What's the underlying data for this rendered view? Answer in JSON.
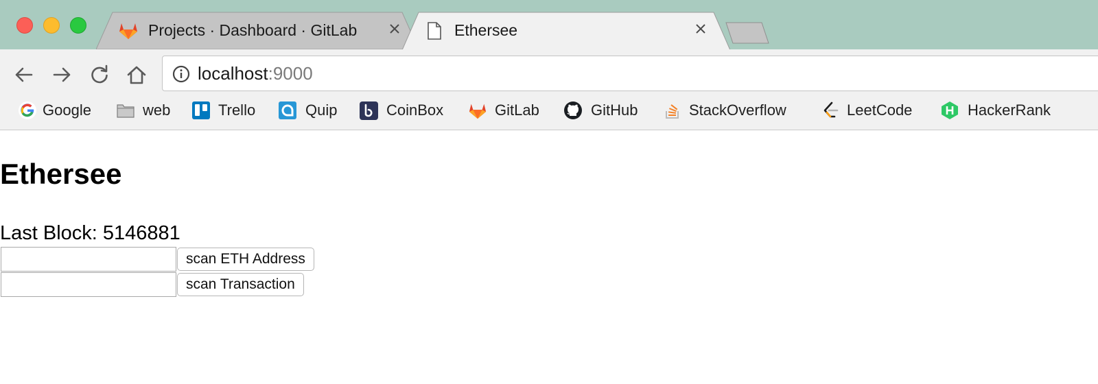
{
  "browser": {
    "tabs": [
      {
        "title": "Projects · Dashboard · GitLab",
        "icon": "gitlab-icon",
        "active": false
      },
      {
        "title": "Ethersee",
        "icon": "page-icon",
        "active": true
      }
    ],
    "address_bar": {
      "host": "localhost",
      "port": ":9000"
    },
    "bookmarks": [
      {
        "label": "Google",
        "icon": "google-icon"
      },
      {
        "label": "web",
        "icon": "folder-icon"
      },
      {
        "label": "Trello",
        "icon": "trello-icon"
      },
      {
        "label": "Quip",
        "icon": "quip-icon"
      },
      {
        "label": "CoinBox",
        "icon": "coinbox-icon"
      },
      {
        "label": "GitLab",
        "icon": "gitlab-icon"
      },
      {
        "label": "GitHub",
        "icon": "github-icon"
      },
      {
        "label": "StackOverflow",
        "icon": "stackoverflow-icon"
      },
      {
        "label": "LeetCode",
        "icon": "leetcode-icon"
      },
      {
        "label": "HackerRank",
        "icon": "hackerrank-icon"
      }
    ]
  },
  "page": {
    "title": "Ethersee",
    "last_block_label": "Last Block: 5146881",
    "address_form": {
      "input_value": "",
      "button_label": "scan ETH Address"
    },
    "transaction_form": {
      "input_value": "",
      "button_label": "scan Transaction"
    }
  },
  "colors": {
    "tabstrip_bg": "#a9cbbf",
    "toolbar_bg": "#f1f1f1",
    "close_light": "#fc5f57",
    "minimize_light": "#fdbc2e",
    "maximize_light": "#29c940"
  }
}
